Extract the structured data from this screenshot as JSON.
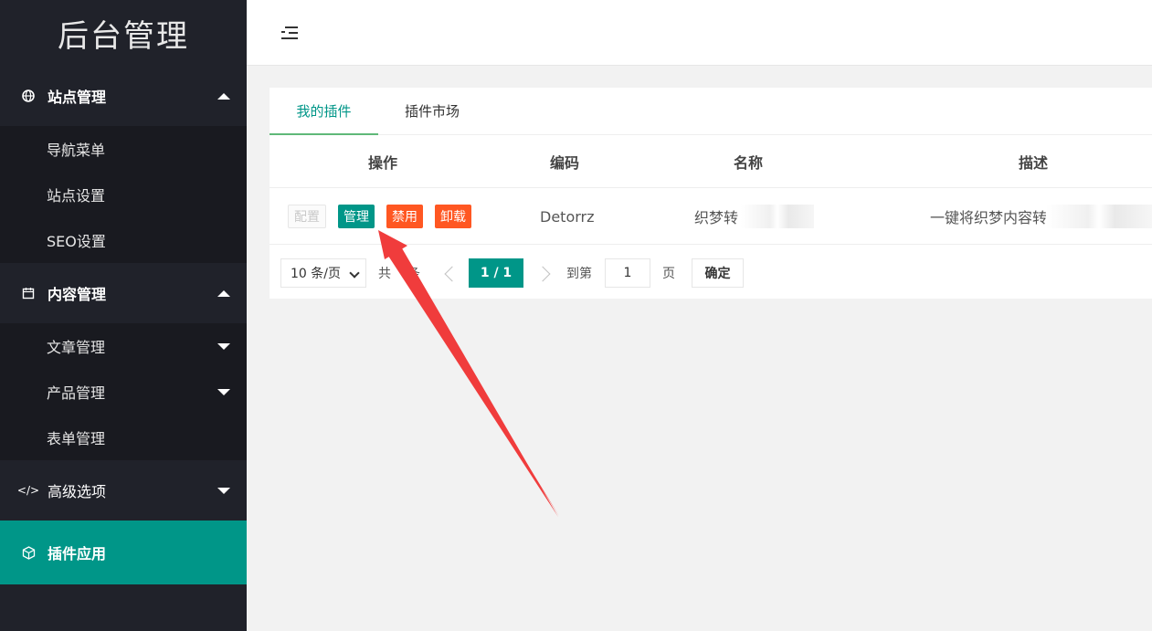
{
  "sidebar": {
    "logo": "后台管理",
    "groups": [
      {
        "label": "站点管理",
        "icon": "globe-icon",
        "expanded": true,
        "items": [
          {
            "label": "导航菜单"
          },
          {
            "label": "站点设置"
          },
          {
            "label": "SEO设置"
          }
        ]
      },
      {
        "label": "内容管理",
        "icon": "calendar-icon",
        "expanded": true,
        "items": [
          {
            "label": "文章管理"
          },
          {
            "label": "产品管理"
          },
          {
            "label": "表单管理"
          }
        ]
      },
      {
        "label": "高级选项",
        "icon": "code-icon",
        "expanded": false
      },
      {
        "label": "插件应用",
        "icon": "cube-icon",
        "active": true
      }
    ]
  },
  "header": {
    "toggle_icon": "menu-fold-icon"
  },
  "tabs": [
    {
      "label": "我的插件",
      "active": true
    },
    {
      "label": "插件市场"
    }
  ],
  "table": {
    "columns": [
      "操作",
      "编码",
      "名称",
      "描述"
    ],
    "rows": [
      {
        "actions": [
          "配置",
          "管理",
          "禁用",
          "卸载"
        ],
        "code": "Detorrz",
        "name": "织梦转",
        "description": "一键将织梦内容转"
      }
    ]
  },
  "pager": {
    "page_size": "10 条/页",
    "total_prefix": "共",
    "total_suffix": "条",
    "current": "1 / 1",
    "goto_label": "到第",
    "goto_value": "1",
    "page_unit": "页",
    "confirm": "确定"
  },
  "colors": {
    "accent": "#009688",
    "danger": "#FF5722",
    "sidebar": "#20222a",
    "annotation": "#f03c3c"
  }
}
